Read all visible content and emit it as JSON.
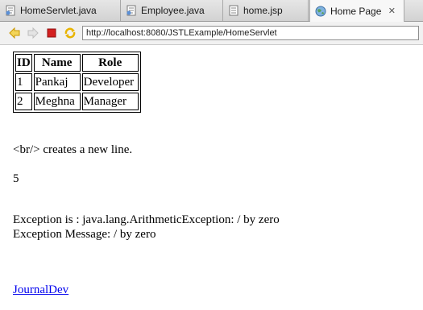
{
  "tabs": [
    {
      "label": "HomeServlet.java",
      "icon": "java-file-icon"
    },
    {
      "label": "Employee.java",
      "icon": "java-file-icon"
    },
    {
      "label": "home.jsp",
      "icon": "jsp-file-icon"
    },
    {
      "label": "Home Page",
      "icon": "globe-icon",
      "active": true,
      "close": "✕"
    }
  ],
  "toolbar": {
    "url": "http://localhost:8080/JSTLExample/HomeServlet",
    "back_icon": "back-arrow-icon",
    "forward_icon": "forward-arrow-icon",
    "stop_icon": "stop-icon",
    "refresh_icon": "refresh-icon"
  },
  "page": {
    "table": {
      "headers": [
        "ID",
        "Name",
        "Role"
      ],
      "rows": [
        [
          "1",
          "Pankaj",
          "Developer"
        ],
        [
          "2",
          "Meghna",
          "Manager"
        ]
      ]
    },
    "br_text": "<br/> creates a new line.",
    "number": "5",
    "exception_line": "Exception is : java.lang.ArithmeticException: / by zero",
    "exception_message": "Exception Message: / by zero",
    "link_text": "JournalDev"
  },
  "colors": {
    "link": "#0000ee",
    "stop_red": "#d42020",
    "arrow_yellow": "#e8b400"
  }
}
